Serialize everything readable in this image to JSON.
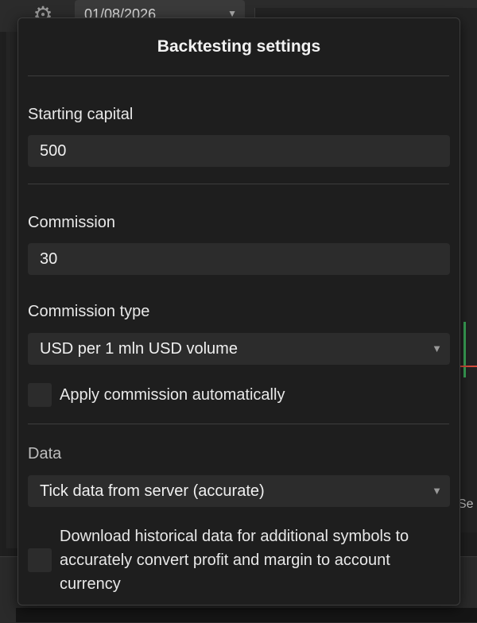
{
  "background": {
    "date_value": "01/08/2026",
    "chart_axis_label": "Se"
  },
  "dialog": {
    "title": "Backtesting settings",
    "starting_capital": {
      "label": "Starting capital",
      "value": "500"
    },
    "commission": {
      "label": "Commission",
      "value": "30"
    },
    "commission_type": {
      "label": "Commission type",
      "selected": "USD per 1 mln USD volume"
    },
    "apply_commission": {
      "label": "Apply commission automatically",
      "checked": false
    },
    "data": {
      "label": "Data",
      "selected": "Tick data from server (accurate)"
    },
    "download_history": {
      "label": "Download historical data for additional symbols to accurately convert profit and margin to account currency",
      "checked": false
    }
  },
  "colors": {
    "dialog_bg": "#1e1e1e",
    "field_bg": "#2c2c2c",
    "accent_green": "#3aa657",
    "accent_red": "#d44b3b"
  }
}
